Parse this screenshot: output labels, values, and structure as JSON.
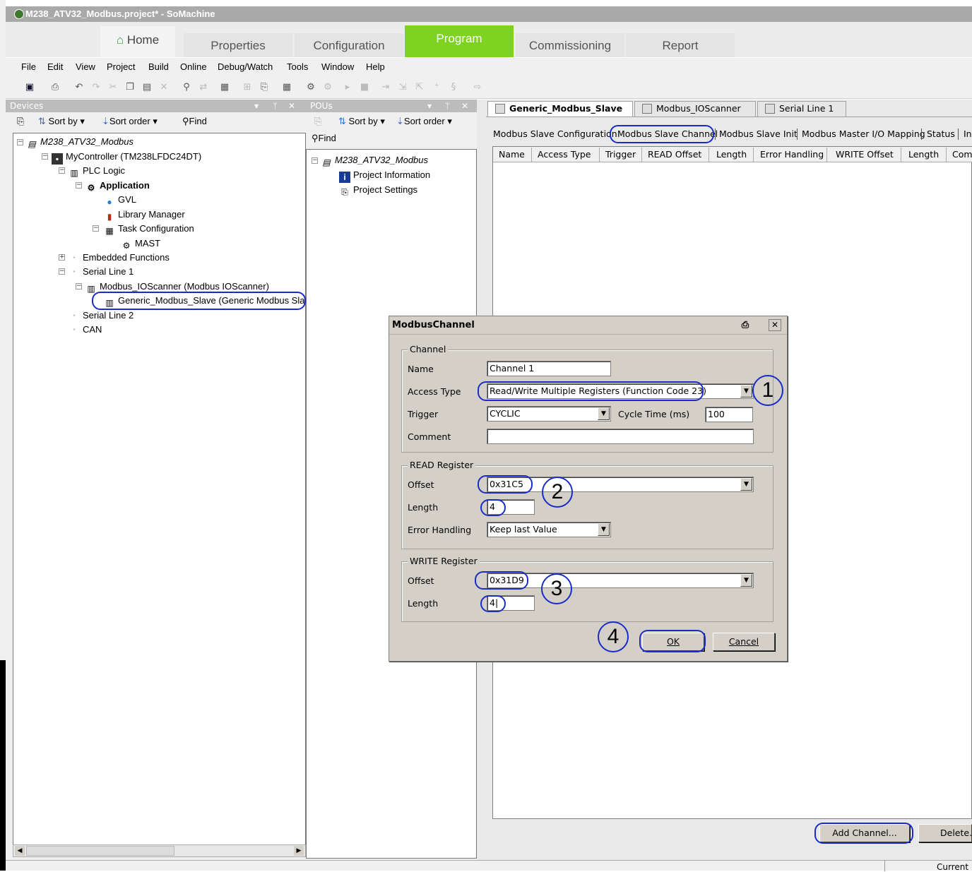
{
  "window": {
    "title": "M238_ATV32_Modbus.project* - SoMachine"
  },
  "ribbon": {
    "tabs": [
      "Home",
      "Properties",
      "Configuration",
      "Program",
      "Commissioning",
      "Report"
    ]
  },
  "menu": [
    "File",
    "Edit",
    "View",
    "Project",
    "Build",
    "Online",
    "Debug/Watch",
    "Tools",
    "Window",
    "Help"
  ],
  "devices": {
    "header": "Devices",
    "sort_by": "Sort by",
    "sort_order": "Sort order",
    "find": "Find",
    "tree": [
      "M238_ATV32_Modbus",
      "MyController (TM238LFDC24DT)",
      "PLC Logic",
      "Application",
      "GVL",
      "Library Manager",
      "Task Configuration",
      "MAST",
      "Embedded Functions",
      "Serial Line 1",
      "Modbus_IOScanner (Modbus IOScanner)",
      "Generic_Modbus_Slave (Generic Modbus Slave)",
      "Serial Line 2",
      "CAN"
    ]
  },
  "pous": {
    "header": "POUs",
    "sort_by": "Sort by",
    "sort_order": "Sort order",
    "find": "Find",
    "tree": [
      "M238_ATV32_Modbus",
      "Project Information",
      "Project Settings"
    ]
  },
  "editor": {
    "doc_tabs": [
      "Generic_Modbus_Slave",
      "Modbus_IOScanner",
      "Serial Line 1"
    ],
    "sub_tabs": [
      "Modbus Slave Configuration",
      "Modbus Slave Channel",
      "Modbus Slave Init",
      "Modbus Master I/O Mapping",
      "Status",
      "In"
    ],
    "columns": [
      "Name",
      "Access Type",
      "Trigger",
      "READ Offset",
      "Length",
      "Error Handling",
      "WRITE Offset",
      "Length",
      "Comm"
    ],
    "add_channel": "Add Channel...",
    "delete": "Delete..."
  },
  "dialog": {
    "title": "ModbusChannel",
    "channel_group": "Channel",
    "name_label": "Name",
    "name_value": "Channel 1",
    "access_type_label": "Access Type",
    "access_type_value": "Read/Write Multiple Registers (Function Code 23)",
    "trigger_label": "Trigger",
    "trigger_value": "CYCLIC",
    "cycle_time_label": "Cycle Time (ms)",
    "cycle_time_value": "100",
    "comment_label": "Comment",
    "comment_value": "",
    "read_group": "READ Register",
    "read_offset_label": "Offset",
    "read_offset_value": "0x31C5",
    "read_length_label": "Length",
    "read_length_value": "4",
    "error_handling_label": "Error Handling",
    "error_handling_value": "Keep last Value",
    "write_group": "WRITE Register",
    "write_offset_label": "Offset",
    "write_offset_value": "0x31D9",
    "write_length_label": "Length",
    "write_length_value": "4|",
    "ok": "OK",
    "cancel": "Cancel"
  },
  "callouts": [
    "1",
    "2",
    "3",
    "4"
  ],
  "statusbar": {
    "right": "Current"
  },
  "colors": {
    "program_tab": "#7ed321",
    "highlight": "#1a2cc8",
    "dialog_bg": "#d4d0c8"
  }
}
